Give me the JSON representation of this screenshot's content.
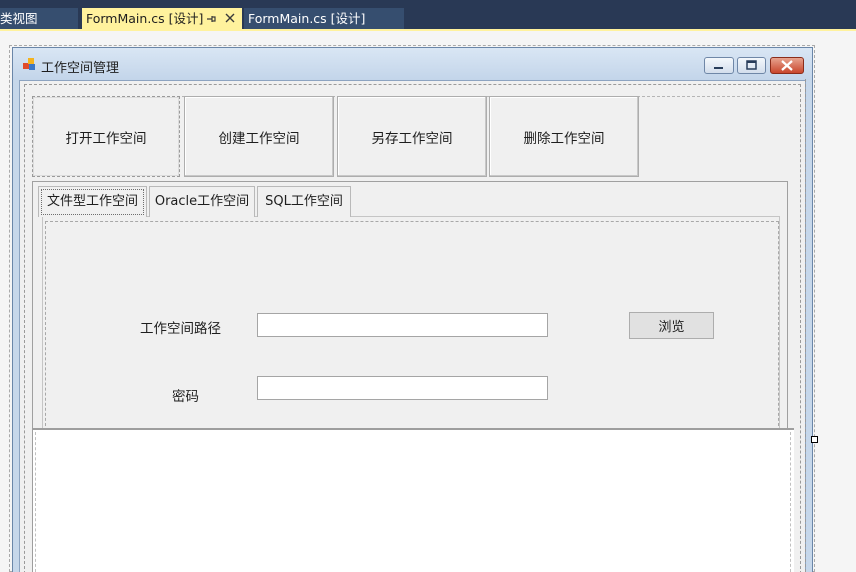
{
  "document_tabs": [
    {
      "label": "类视图",
      "active": false
    },
    {
      "label": "FormMain.cs [设计]",
      "active": true,
      "pin_icon": "pin-icon",
      "close_icon": "close-icon"
    },
    {
      "label": "FormMain.cs [设计]",
      "active": false
    }
  ],
  "form": {
    "title": "工作空间管理",
    "app_icon": "app-icon",
    "caption_buttons": [
      "minimize-icon",
      "restore-icon",
      "close-icon"
    ]
  },
  "toolbar": {
    "buttons": [
      {
        "label": "打开工作空间"
      },
      {
        "label": "创建工作空间"
      },
      {
        "label": "另存工作空间"
      },
      {
        "label": "删除工作空间"
      }
    ]
  },
  "tabs": [
    {
      "label": "文件型工作空间",
      "selected": true
    },
    {
      "label": "Oracle工作空间",
      "selected": false
    },
    {
      "label": "SQL工作空间",
      "selected": false
    }
  ],
  "file_tab": {
    "path_label": "工作空间路径",
    "path_value": "",
    "browse_label": "浏览",
    "password_label": "密码",
    "password_value": ""
  },
  "colors": {
    "vs_chrome": "#293955",
    "active_tab": "#fff29d",
    "form_background": "#f0f0f0",
    "title_bar": "#c6d7ea"
  }
}
